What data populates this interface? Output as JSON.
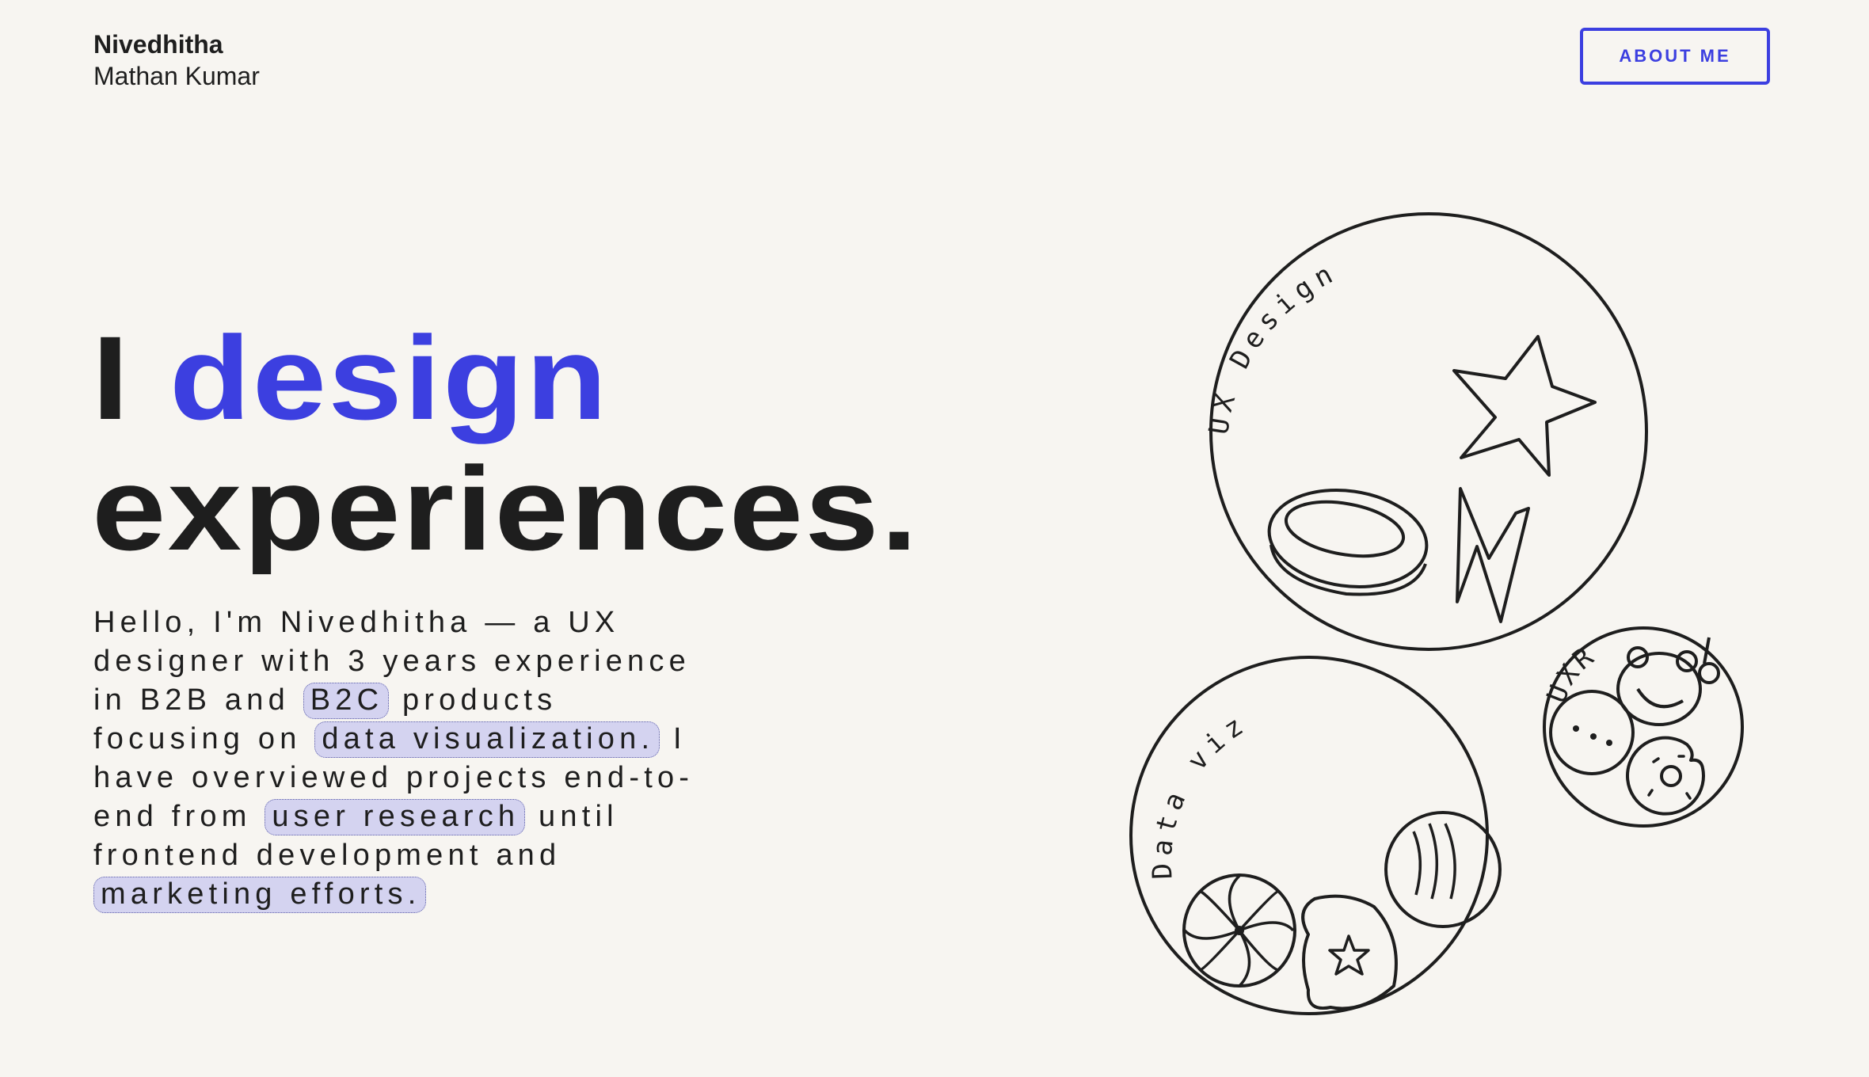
{
  "header": {
    "first_name": "Nivedhitha",
    "last_name": "Mathan Kumar",
    "about_button": "ABOUT ME"
  },
  "hero": {
    "word1": "I",
    "word2": "design",
    "word3": "experiences."
  },
  "intro": {
    "l1": "Hello, I'm Nivedhitha — a UX",
    "l2": "designer with 3 years experience",
    "l3_a": "in B2B and ",
    "l3_pill": "B2C",
    "l3_b": " products",
    "l4_a": "focusing on ",
    "l4_pill": "data visualization.",
    "l4_b": " I",
    "l5": "have overviewed projects end-to-",
    "l6_a": "end from ",
    "l6_pill": "user research",
    "l6_b": " until",
    "l7": "frontend development and",
    "l8_pill": "marketing efforts."
  },
  "circles": {
    "ux_design": "UX Design",
    "data_viz": "Data viz",
    "uxr": "UXR"
  },
  "icons": [
    "star-icon",
    "ring-icon",
    "lightning-icon",
    "peppermint-candy-icon",
    "cookie-star-icon",
    "sphere-icon",
    "donut-icon",
    "face-icon"
  ],
  "colors": {
    "accent": "#3c3fe0",
    "background": "#f7f5f1",
    "text": "#1e1e1e",
    "highlight": "#d4d3f0"
  }
}
